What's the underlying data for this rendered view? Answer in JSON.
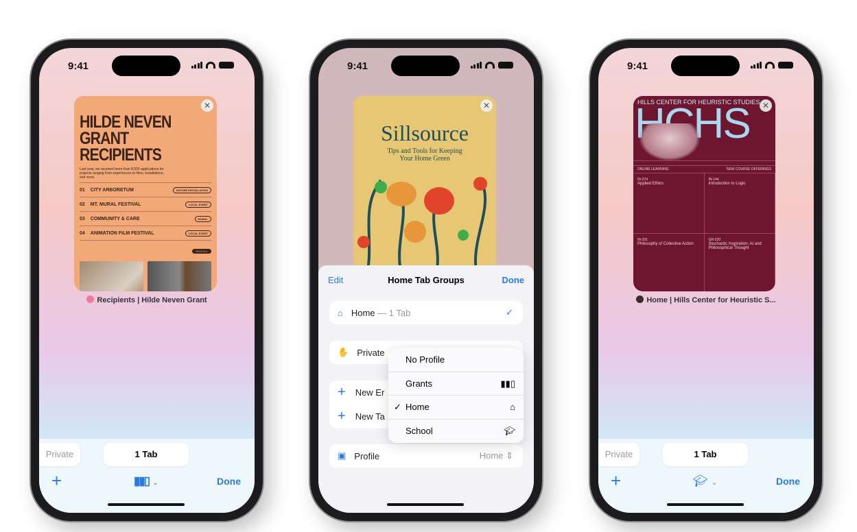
{
  "status": {
    "time": "9:41"
  },
  "phones": [
    {
      "card": {
        "title": "HILDE NEVEN GRANT RECIPIENTS",
        "intro": "Last year, we received more than 8,000 applications for projects ranging from experiences to films, installations, and more.",
        "items": [
          {
            "num": "01",
            "name": "CITY ARBORETUM",
            "tag": "NATURE INSTALLATION"
          },
          {
            "num": "02",
            "name": "MT. MURAL FESTIVAL",
            "tag": "LOCAL EVENT"
          },
          {
            "num": "03",
            "name": "COMMUNITY & CARE",
            "tag": "MURAL"
          },
          {
            "num": "04",
            "name": "ANIMATION FILM FESTIVAL",
            "tag": "LOCAL EVENT"
          }
        ],
        "view_all": "VIEW ALL",
        "caption": "Recipients | Hilde Neven Grant"
      },
      "tabs": {
        "private": "Private",
        "current": "1 Tab"
      },
      "done": "Done",
      "profile_icon": "books-icon"
    },
    {
      "card": {
        "title": "Sillsource",
        "subtitle": "Tips and Tools for Keeping Your Home Green"
      },
      "sheet": {
        "edit": "Edit",
        "title": "Home Tab Groups",
        "done": "Done",
        "home_row": {
          "label": "Home",
          "count": "— 1 Tab"
        },
        "private_row": "Private",
        "new_rows": [
          "New Er",
          "New Ta"
        ],
        "menu": [
          {
            "label": "No Profile",
            "icon": ""
          },
          {
            "label": "Grants",
            "icon": "books-icon"
          },
          {
            "label": "Home",
            "icon": "house-icon",
            "checked": true
          },
          {
            "label": "School",
            "icon": "graduation-cap-icon"
          }
        ],
        "profile_row": {
          "label": "Profile",
          "value": "Home"
        }
      }
    },
    {
      "card": {
        "header": "HILLS CENTER FOR HEURISTIC STUDIES",
        "logo": "HCHS",
        "left": "ONLINE LEARNING",
        "right": "NEW COURSE OFFERINGS",
        "courses": [
          {
            "code": "IN-374",
            "name": "Applied Ethics"
          },
          {
            "code": "IN-144",
            "name": "Introduction to Logic"
          },
          {
            "code": "IN-201",
            "name": "Philosophy of Collective Action"
          },
          {
            "code": "GR-220",
            "name": "Stochastic Inspiration: AI and Philosophical Thought"
          }
        ],
        "caption": "Home | Hills Center for Heuristic S..."
      },
      "tabs": {
        "private": "Private",
        "current": "1 Tab"
      },
      "done": "Done",
      "profile_icon": "graduation-cap-icon"
    }
  ],
  "colors": {
    "accent": "#2a7ae2",
    "hilde": "#f2a877",
    "sill": "#e7c674",
    "hchs": "#6e1630"
  }
}
